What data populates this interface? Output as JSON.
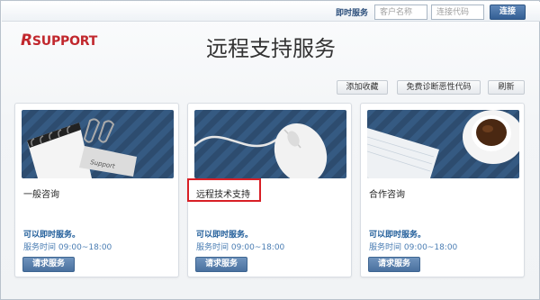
{
  "header": {
    "label": "即时服务",
    "customer_placeholder": "客户名称",
    "code_placeholder": "连接代码",
    "connect_label": "连接"
  },
  "logo": {
    "text": "SUPPORT",
    "initial": "R"
  },
  "page_title": "远程支持服务",
  "toolbar": {
    "favorite_label": "添加收藏",
    "diagnose_label": "免费诊断恶性代码",
    "refresh_label": "刷新"
  },
  "cards": [
    {
      "title": "一般咨询",
      "availability": "可以即时服务。",
      "hours": "服务时间 09:00~18:00",
      "button": "请求服务"
    },
    {
      "title": "远程技术支持",
      "availability": "可以即时服务。",
      "hours": "服务时间 09:00~18:00",
      "button": "请求服务"
    },
    {
      "title": "合作咨询",
      "availability": "可以即时服务。",
      "hours": "服务时间 09:00~18:00",
      "button": "请求服务"
    }
  ],
  "colors": {
    "brand": "#c1272d",
    "accent_blue": "#335f94",
    "highlight": "#d81f26"
  }
}
